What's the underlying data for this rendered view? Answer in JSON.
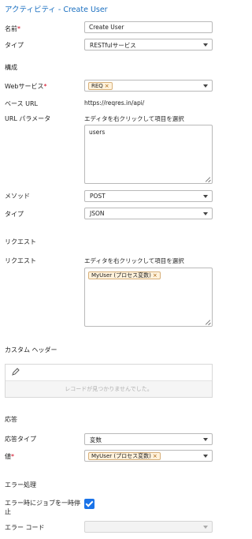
{
  "header": {
    "title": "アクティビティ  - Create User"
  },
  "fields": {
    "name": {
      "label": "名前",
      "required_mark": "*",
      "value": "Create User"
    },
    "type": {
      "label": "タイプ",
      "value": "RESTfulサービス"
    }
  },
  "config": {
    "section": "構成",
    "web_service": {
      "label": "Webサービス",
      "required_mark": "*",
      "chip": "REQ",
      "chip_remove": "×"
    },
    "base_url": {
      "label": "ベース URL",
      "value": "https://reqres.in/api/"
    },
    "url_params": {
      "label": "URL パラメータ",
      "hint": "エディタを右クリックして項目を選択",
      "value": "users"
    },
    "method": {
      "label": "メソッド",
      "value": "POST"
    },
    "content_type": {
      "label": "タイプ",
      "value": "JSON"
    }
  },
  "request": {
    "section": "リクエスト",
    "label": "リクエスト",
    "hint": "エディタを右クリックして項目を選択",
    "chip": "MyUser (プロセス変数)",
    "chip_remove": "×"
  },
  "custom_headers": {
    "section": "カスタム ヘッダー",
    "empty_text": "レコードが見つかりませんでした。"
  },
  "response": {
    "section": "応答",
    "response_type": {
      "label": "応答タイプ",
      "value": "変数"
    },
    "value": {
      "label": "値",
      "required_mark": "*",
      "chip": "MyUser (プロセス変数)",
      "chip_remove": "×"
    }
  },
  "error_handling": {
    "section": "エラー処理",
    "pause_on_error": {
      "label_line1": "エラー時にジョブを一時停",
      "label_line2": "止",
      "checked": true
    },
    "error_code": {
      "label": "エラー コード",
      "value": ""
    }
  },
  "colors": {
    "accent": "#1a73e8",
    "title": "#1a6fc0",
    "required": "#d0021b",
    "chip_bg": "#fff2dc",
    "chip_border": "#d7b07a"
  }
}
